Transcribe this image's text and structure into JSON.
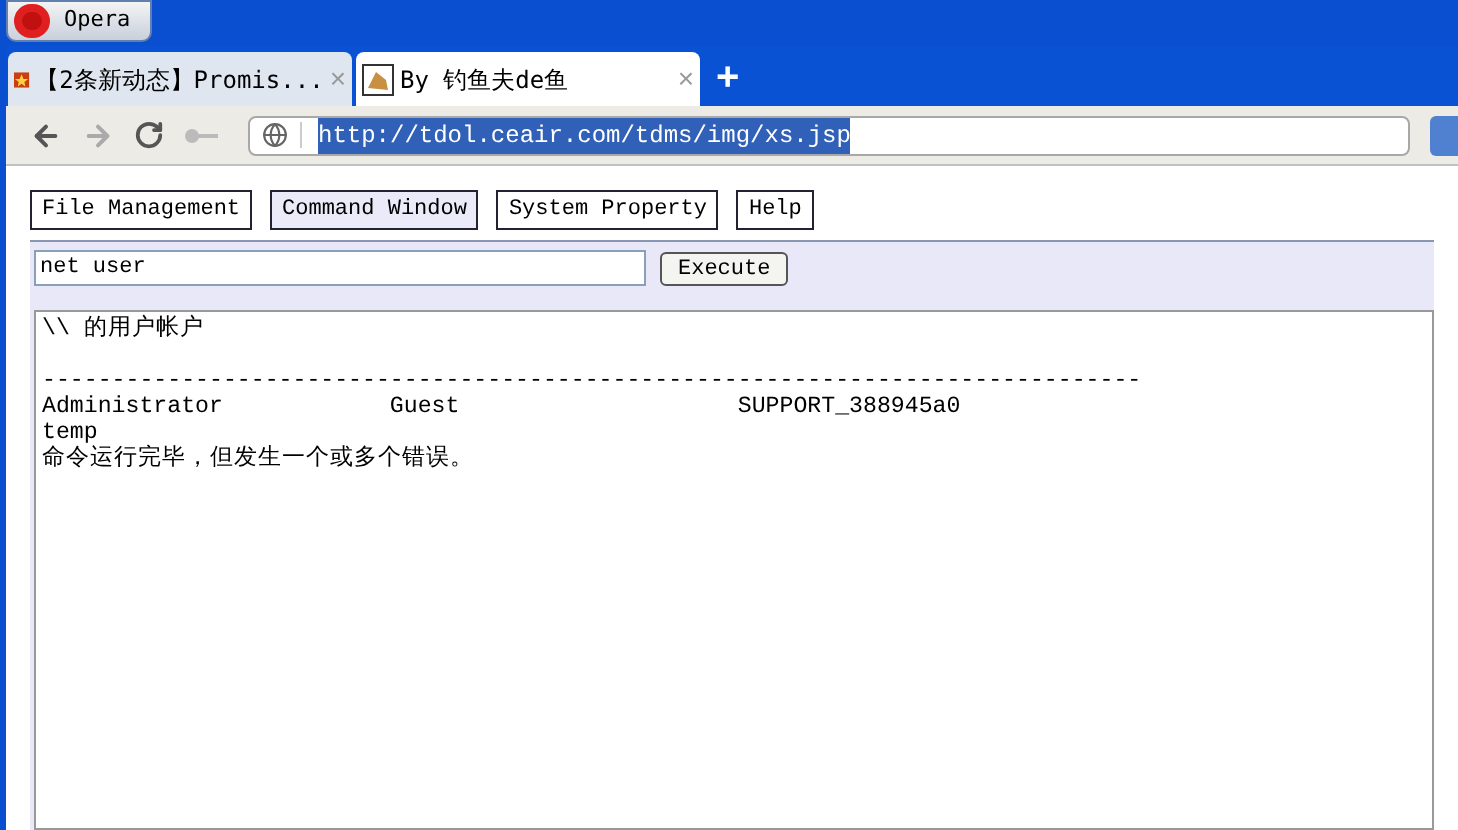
{
  "menu_button": {
    "label": "Opera"
  },
  "tabs": [
    {
      "title": "【2条新动态】Promis...",
      "close": "×",
      "selected": false
    },
    {
      "title": "By 钓鱼夫de鱼",
      "close": "×",
      "selected": true
    }
  ],
  "new_tab": {
    "label": "+"
  },
  "address_bar": {
    "url": "http://tdol.ceair.com/tdms/img/xs.jsp",
    "url_selected": true
  },
  "nav": [
    {
      "label": "File Management",
      "selected": false
    },
    {
      "label": "Command Window",
      "selected": true
    },
    {
      "label": "System Property",
      "selected": false
    },
    {
      "label": "Help",
      "selected": false
    }
  ],
  "command": {
    "value": "net user",
    "button": "Execute"
  },
  "output": "\\\\ 的用户帐户\n\n-------------------------------------------------------------------------------\nAdministrator            Guest                    SUPPORT_388945a0\ntemp\n命令运行完毕，但发生一个或多个错误。"
}
